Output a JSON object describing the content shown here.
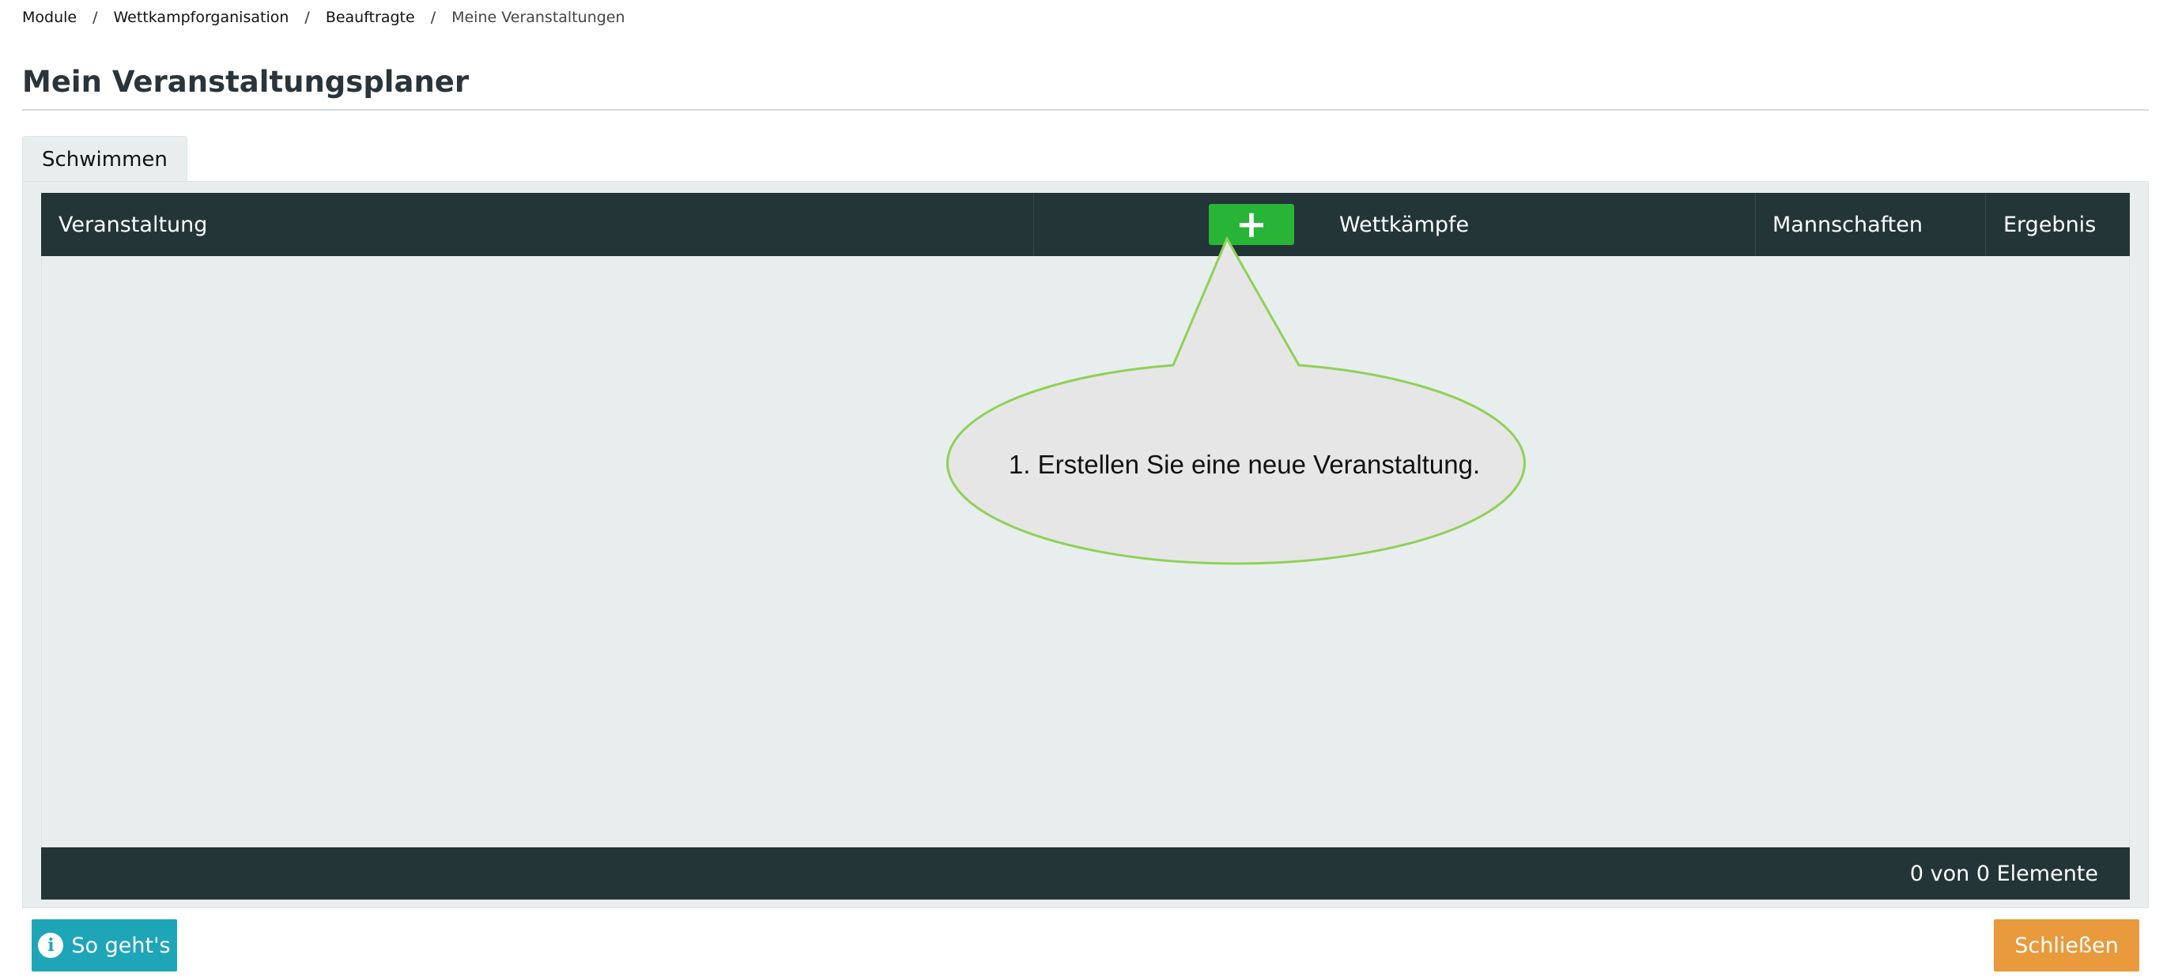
{
  "breadcrumb": {
    "items": [
      "Module",
      "Wettkampforganisation",
      "Beauftragte",
      "Meine Veranstaltungen"
    ],
    "separator": "/"
  },
  "page": {
    "title": "Mein Veranstaltungsplaner"
  },
  "tabs": [
    {
      "label": "Schwimmen",
      "active": true
    }
  ],
  "table": {
    "columns": [
      "Veranstaltung",
      "Wettkämpfe",
      "Mannschaften",
      "Ergebnis"
    ],
    "add_button_icon": "plus-icon",
    "add_button_symbol": "+",
    "rows": [],
    "footer_info": "0 von 0 Elemente"
  },
  "callout": {
    "text": "1. Erstellen Sie eine neue Veranstaltung."
  },
  "actions": {
    "help_label": "So geht's",
    "help_icon": "info-icon",
    "help_icon_symbol": "i",
    "close_label": "Schließen"
  },
  "colors": {
    "table_header": "#233536",
    "add_button": "#27b437",
    "help_button": "#1ea5b8",
    "close_button": "#e89a3c",
    "callout_fill": "#e6e6e6",
    "callout_stroke": "#8fd158",
    "panel_bg": "#e8eeed"
  }
}
